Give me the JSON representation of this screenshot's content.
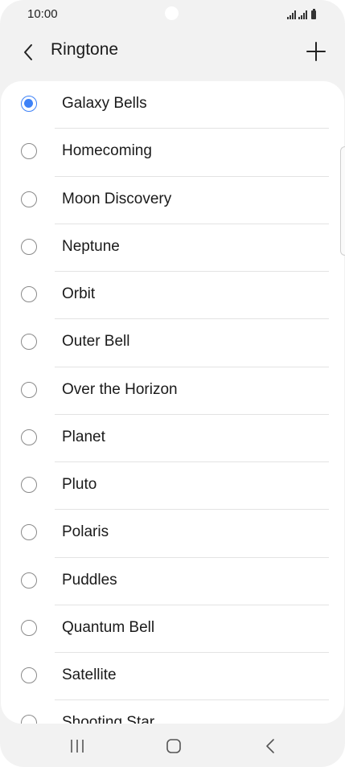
{
  "status_bar": {
    "time": "10:00"
  },
  "header": {
    "title": "Ringtone",
    "back_icon": "chevron-left-icon",
    "add_icon": "plus-icon"
  },
  "ringtones": [
    {
      "label": "Galaxy Bells",
      "selected": true
    },
    {
      "label": "Homecoming",
      "selected": false
    },
    {
      "label": "Moon Discovery",
      "selected": false
    },
    {
      "label": "Neptune",
      "selected": false
    },
    {
      "label": "Orbit",
      "selected": false
    },
    {
      "label": "Outer Bell",
      "selected": false
    },
    {
      "label": "Over the Horizon",
      "selected": false
    },
    {
      "label": "Planet",
      "selected": false
    },
    {
      "label": "Pluto",
      "selected": false
    },
    {
      "label": "Polaris",
      "selected": false
    },
    {
      "label": "Puddles",
      "selected": false
    },
    {
      "label": "Quantum Bell",
      "selected": false
    },
    {
      "label": "Satellite",
      "selected": false
    },
    {
      "label": "Shooting Star",
      "selected": false
    }
  ],
  "colors": {
    "accent": "#3e82f7",
    "background": "#f2f2f2",
    "card": "#ffffff"
  },
  "nav_bar": {
    "recents_icon": "recent-apps-icon",
    "home_icon": "home-icon",
    "back_icon": "back-icon"
  }
}
